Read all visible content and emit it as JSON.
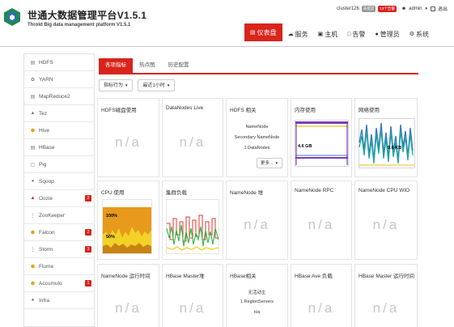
{
  "header": {
    "title": "世通大数据管理平台V1.5.1",
    "subtitle": "Throld Big data management platform V1.5.1",
    "cluster": "cluster126",
    "cluster_badge": "未提交",
    "alert_badge": "13个告警",
    "user": "admin",
    "logout": "退出",
    "nav": [
      {
        "label": "仪表盘",
        "icon": "dashboard-icon",
        "active": true
      },
      {
        "label": "服务",
        "icon": "cloud-icon",
        "active": false
      },
      {
        "label": "主机",
        "icon": "hosts-icon",
        "active": false
      },
      {
        "label": "告警",
        "icon": "alerts-icon",
        "active": false
      },
      {
        "label": "管理员",
        "icon": "admin-user-icon",
        "active": false
      },
      {
        "label": "系统",
        "icon": "gear-icon",
        "active": false
      }
    ]
  },
  "sidebar": {
    "items": [
      {
        "label": "HDFS",
        "icon": "hdfs-icon",
        "badge": ""
      },
      {
        "label": "YARN",
        "icon": "yarn-icon",
        "badge": ""
      },
      {
        "label": "MapReduce2",
        "icon": "mapreduce-icon",
        "badge": ""
      },
      {
        "label": "Tez",
        "icon": "tez-icon",
        "badge": ""
      },
      {
        "label": "Hive",
        "icon": "hive-icon",
        "badge": ""
      },
      {
        "label": "HBase",
        "icon": "hbase-icon",
        "badge": ""
      },
      {
        "label": "Pig",
        "icon": "pig-icon",
        "badge": ""
      },
      {
        "label": "Sqoop",
        "icon": "sqoop-icon",
        "badge": ""
      },
      {
        "label": "Oozie",
        "icon": "oozie-icon",
        "badge": "2"
      },
      {
        "label": "ZooKeeper",
        "icon": "zookeeper-icon",
        "badge": ""
      },
      {
        "label": "Falcon",
        "icon": "falcon-icon",
        "badge": "2"
      },
      {
        "label": "Storm",
        "icon": "storm-icon",
        "badge": "3"
      },
      {
        "label": "Flume",
        "icon": "flume-icon",
        "badge": ""
      },
      {
        "label": "Accumulo",
        "icon": "accumulo-icon",
        "badge": "1"
      },
      {
        "label": "Infra",
        "icon": "infra-icon",
        "badge": ""
      }
    ]
  },
  "tabs": [
    {
      "label": "各项指标",
      "active": true
    },
    {
      "label": "热点图",
      "active": false
    },
    {
      "label": "历史配置",
      "active": false
    }
  ],
  "filters": {
    "metric_action": "指标行为",
    "time_range": "最近1小时"
  },
  "cards": {
    "hdfs_disk": {
      "title": "HDFS磁盘使用",
      "value": "n/a"
    },
    "datanodes_live": {
      "title": "DataNodes Live",
      "value": "n/a"
    },
    "hdfs_related": {
      "title": "HDFS 相关",
      "lines": [
        "NameNode",
        "Secondary NameNode",
        "1 DataNodes"
      ],
      "more": "更多..."
    },
    "memory": {
      "title": "内存使用",
      "label": "4.6 GB"
    },
    "network": {
      "title": "网络使用",
      "label": "9.6 KB"
    },
    "cpu": {
      "title": "CPU 使用",
      "label_top": "100%",
      "label_mid": "50%"
    },
    "cluster_load": {
      "title": "集群负载"
    },
    "namenode_heap": {
      "title": "NameNode 堆",
      "value": "n/a"
    },
    "namenode_rpc": {
      "title": "NameNode RPC",
      "value": "n/a"
    },
    "namenode_cpu": {
      "title": "NameNode CPU WIO",
      "value": "n/a"
    },
    "namenode_uptime": {
      "title": "NameNode 运行时间",
      "value": "n/a"
    },
    "hbase_master_heap": {
      "title": "HBase Master堆",
      "value": "n/a"
    },
    "hbase_related": {
      "title": "HBase相关",
      "lines": [
        "无活动主",
        "1 RegionServers",
        "n/a"
      ]
    },
    "hbase_ave_load": {
      "title": "HBase Ave 负载",
      "value": "n/a"
    },
    "hbase_master_uptime": {
      "title": "HBase Master 运行时间",
      "value": "n/a"
    }
  },
  "colors": {
    "accent": "#d9241c",
    "memory_purple": "#7b3fb6",
    "memory_yellow": "#e8c31a",
    "network_blue": "#3a78c4",
    "network_teal": "#1aa79a",
    "cpu_orange": "#e79a1c",
    "cpu_yellow": "#f3d227",
    "load_green": "#35b547",
    "load_red": "#e03a2c"
  }
}
